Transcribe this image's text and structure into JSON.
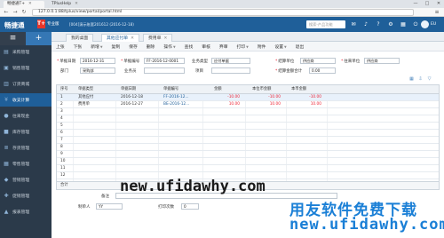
{
  "browser": {
    "tabs": [
      {
        "label": "畅捷通T+",
        "active": true
      },
      {
        "label": "TPlusHelp",
        "active": false
      }
    ],
    "url": "127.0.0.1:88/tplus/view/portal/portal.html",
    "window_controls": [
      "—",
      "□",
      "✕"
    ]
  },
  "header": {
    "logo": "畅捷通",
    "badge": "T+",
    "product": "专业版",
    "company": "[004]演示账套201612 (2016-12-18)",
    "search_placeholder": "搜索-产品功能",
    "user": "EU"
  },
  "sidebar": {
    "items": [
      {
        "label": "采购管理",
        "icon": "cart-icon"
      },
      {
        "label": "销售管理",
        "icon": "truck-icon"
      },
      {
        "label": "订货商城",
        "icon": "store-icon"
      },
      {
        "label": "收支计算",
        "icon": "money-icon"
      },
      {
        "label": "往来现金",
        "icon": "coin-icon"
      },
      {
        "label": "库存管理",
        "icon": "box-icon"
      },
      {
        "label": "存货管理",
        "icon": "stack-icon"
      },
      {
        "label": "零售管理",
        "icon": "shop-icon"
      },
      {
        "label": "营销管理",
        "icon": "tag-icon"
      },
      {
        "label": "促销管理",
        "icon": "gift-icon"
      },
      {
        "label": "报表管理",
        "icon": "chart-icon"
      }
    ]
  },
  "content_tabs": [
    {
      "label": "我的桌面",
      "active": false
    },
    {
      "label": "其他应付单",
      "active": true
    },
    {
      "label": "费用单",
      "active": false
    }
  ],
  "toolbar": [
    {
      "label": "上张",
      "caret": false
    },
    {
      "label": "下张",
      "caret": false
    },
    {
      "label": "新增",
      "caret": true
    },
    {
      "label": "复制",
      "caret": false
    },
    {
      "label": "保存",
      "caret": false
    },
    {
      "label": "删除",
      "caret": false
    },
    {
      "label": "操作",
      "caret": true
    },
    {
      "label": "查找",
      "caret": false
    },
    {
      "label": "审核",
      "caret": false
    },
    {
      "label": "弃审",
      "caret": false
    },
    {
      "label": "打印",
      "caret": true
    },
    {
      "label": "附件",
      "caret": false
    },
    {
      "label": "设置",
      "caret": true
    },
    {
      "label": "退出",
      "caret": false
    }
  ],
  "form": {
    "doc_date_label": "单据日期",
    "doc_date": "2016-12-31",
    "doc_no_label": "单据编号",
    "doc_no": "FF-2016-12-0001",
    "biz_type_label": "业务类型",
    "biz_type": "应付单据",
    "settle_unit_label": "结算单位",
    "settle_unit": "供应商",
    "inout_unit_label": "往来单位",
    "inout_unit": "供应商",
    "dept_label": "部门",
    "dept": "采购部",
    "salesman_label": "业务员",
    "salesman": "",
    "project_label": "项目",
    "project": "",
    "amount_label": "结算金额合计",
    "amount": "0.00"
  },
  "grid": {
    "columns": [
      "序号",
      "单据类型",
      "单据日期",
      "单据编号",
      "金额",
      "本位币金额",
      "本币金额"
    ],
    "rows": [
      {
        "no": "1",
        "type": "其他应付",
        "date": "2016-12-18",
        "doc": "FF-2016-12...",
        "amount": "-10.00",
        "base_amount": "-10.00",
        "local_amount": "-10.00"
      },
      {
        "no": "2",
        "type": "费用单",
        "date": "2016-12-27",
        "doc": "BE-2016-12...",
        "amount": "10.00",
        "base_amount": "10.00",
        "local_amount": "10.00"
      }
    ],
    "empty_rows": [
      "3",
      "4",
      "5",
      "6",
      "7",
      "8",
      "9",
      "10",
      "11",
      "12"
    ],
    "total_label": "合计"
  },
  "footer": {
    "note_label": "备注",
    "maker_label": "制单人",
    "maker": "YY",
    "print_label": "打印次数",
    "print_count": "0"
  },
  "watermarks": {
    "line1": "new.ufidawhy.com",
    "line2": "用友软件免费下载",
    "line3_prefix": "new.",
    "line3": "new.ufidawhy.com"
  },
  "colors": {
    "brand_blue": "#1f5f99",
    "sidebar_bg": "#2b3a4a",
    "negative_red": "#e22233",
    "watermark_blue": "#1a7fd6",
    "watermark_orange": "#f07d1a"
  }
}
